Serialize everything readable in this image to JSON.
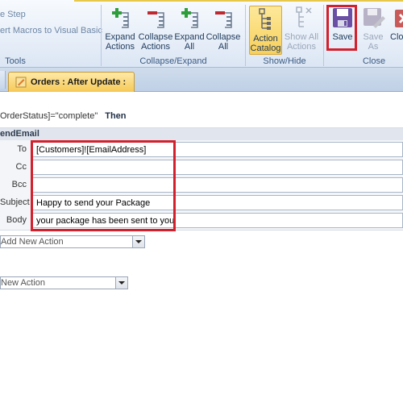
{
  "ribbon": {
    "tools_items": [
      "e Step",
      "ert Macros to Visual Basic"
    ],
    "groups": {
      "tools": "Tools",
      "collapse_expand": "Collapse/Expand",
      "show_hide": "Show/Hide",
      "close": "Close"
    },
    "buttons": {
      "expand_actions": "Expand\nActions",
      "collapse_actions": "Collapse\nActions",
      "expand_all": "Expand\nAll",
      "collapse_all": "Collapse\nAll",
      "action_catalog": "Action\nCatalog",
      "show_all_actions": "Show All\nActions",
      "save": "Save",
      "save_as": "Save\nAs",
      "close": "Clo"
    },
    "colors": {
      "plus": "#2e9e3a",
      "minus": "#c0282e",
      "highlight": "#d2202c"
    }
  },
  "tab": {
    "label": "Orders : After Update :"
  },
  "designer": {
    "condition": {
      "expression": "OrderStatus]=\"complete\"",
      "then": "Then"
    },
    "action": {
      "name": "endEmail",
      "args": [
        {
          "label": "To",
          "value": "[Customers]![EmailAddress]"
        },
        {
          "label": "Cc",
          "value": ""
        },
        {
          "label": "Bcc",
          "value": ""
        },
        {
          "label": "Subject",
          "value": "Happy to send your Package"
        },
        {
          "label": "Body",
          "value": "your package has been sent to you"
        }
      ]
    },
    "add_action_inner": "Add New Action",
    "add_action_outer": "New Action"
  }
}
